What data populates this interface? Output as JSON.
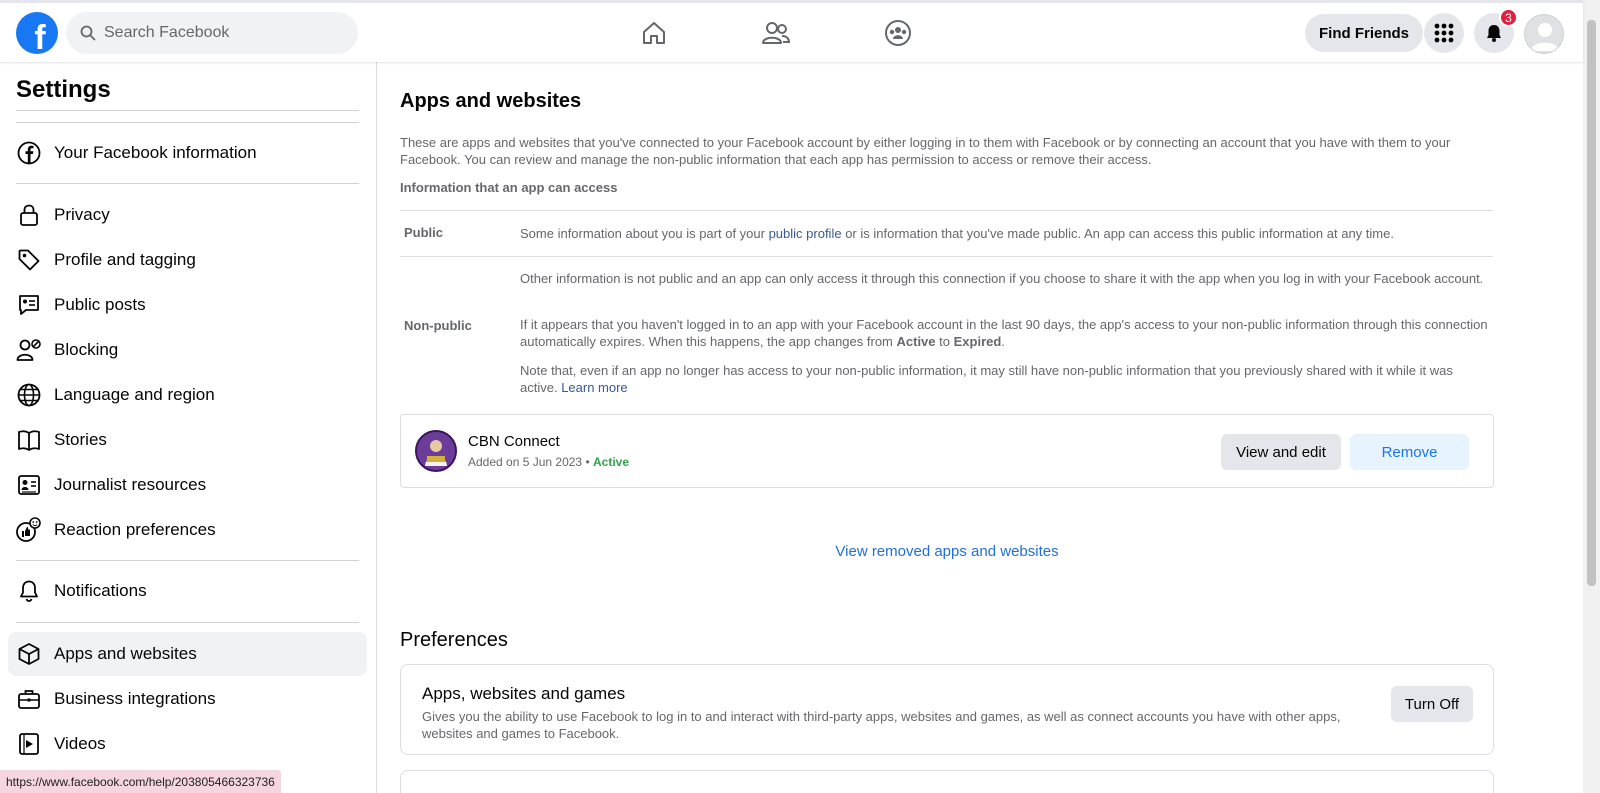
{
  "topbar": {
    "logo": "f",
    "search_placeholder": "Search Facebook",
    "find_friends": "Find Friends",
    "notification_count": "3"
  },
  "sidebar": {
    "title": "Settings",
    "items": [
      {
        "label": "Your Facebook information",
        "icon": "facebook-circle-icon"
      },
      {
        "label": "Privacy",
        "icon": "lock-icon"
      },
      {
        "label": "Profile and tagging",
        "icon": "tag-icon"
      },
      {
        "label": "Public posts",
        "icon": "public-posts-icon"
      },
      {
        "label": "Blocking",
        "icon": "block-user-icon"
      },
      {
        "label": "Language and region",
        "icon": "globe-icon"
      },
      {
        "label": "Stories",
        "icon": "book-icon"
      },
      {
        "label": "Journalist resources",
        "icon": "id-card-icon"
      },
      {
        "label": "Reaction preferences",
        "icon": "reaction-icon"
      },
      {
        "label": "Notifications",
        "icon": "bell-icon"
      },
      {
        "label": "Apps and websites",
        "icon": "cube-icon",
        "active": true
      },
      {
        "label": "Business integrations",
        "icon": "briefcase-icon"
      },
      {
        "label": "Videos",
        "icon": "video-icon"
      }
    ]
  },
  "main": {
    "title": "Apps and websites",
    "intro": "These are apps and websites that you've connected to your Facebook account by either logging in to them with Facebook or by connecting an account that you have with them to your Facebook. You can review and manage the non-public information that each app has permission to access or remove their access.",
    "info_heading": "Information that an app can access",
    "public_label": "Public",
    "public_text_1": "Some information about you is part of your ",
    "public_link": "public profile",
    "public_text_2": " or is information that you've made public. An app can access this public information at any time.",
    "nonpublic_label": "Non-public",
    "nonpublic_p1": "Other information is not public and an app can only access it through this connection if you choose to share it with the app when you log in with your Facebook account.",
    "nonpublic_p2_a": "If it appears that you haven't logged in to an app with your Facebook account in the last 90 days, the app's access to your non-public information through this connection automatically expires. When this happens, the app changes from ",
    "nonpublic_p2_active": "Active",
    "nonpublic_p2_to": " to ",
    "nonpublic_p2_expired": "Expired",
    "nonpublic_p2_end": ".",
    "nonpublic_p3": "Note that, even if an app no longer has access to your non-public information, it may still have non-public information that you previously shared with it while it was active. ",
    "learn_more": "Learn more",
    "app": {
      "name": "CBN Connect",
      "added": "Added on 5 Jun 2023",
      "separator": "•",
      "status": "Active",
      "view_edit": "View and edit",
      "remove": "Remove"
    },
    "removed_link": "View removed apps and websites",
    "preferences_title": "Preferences",
    "pref": {
      "title": "Apps, websites and games",
      "desc": "Gives you the ability to use Facebook to log in to and interact with third-party apps, websites and games, as well as connect accounts you have with other apps, websites and games to Facebook.",
      "button": "Turn Off"
    }
  },
  "status_url": "https://www.facebook.com/help/203805466323736",
  "colors": {
    "brand": "#1877f2",
    "active_status": "#31a24c",
    "badge": "#e41e3f"
  }
}
